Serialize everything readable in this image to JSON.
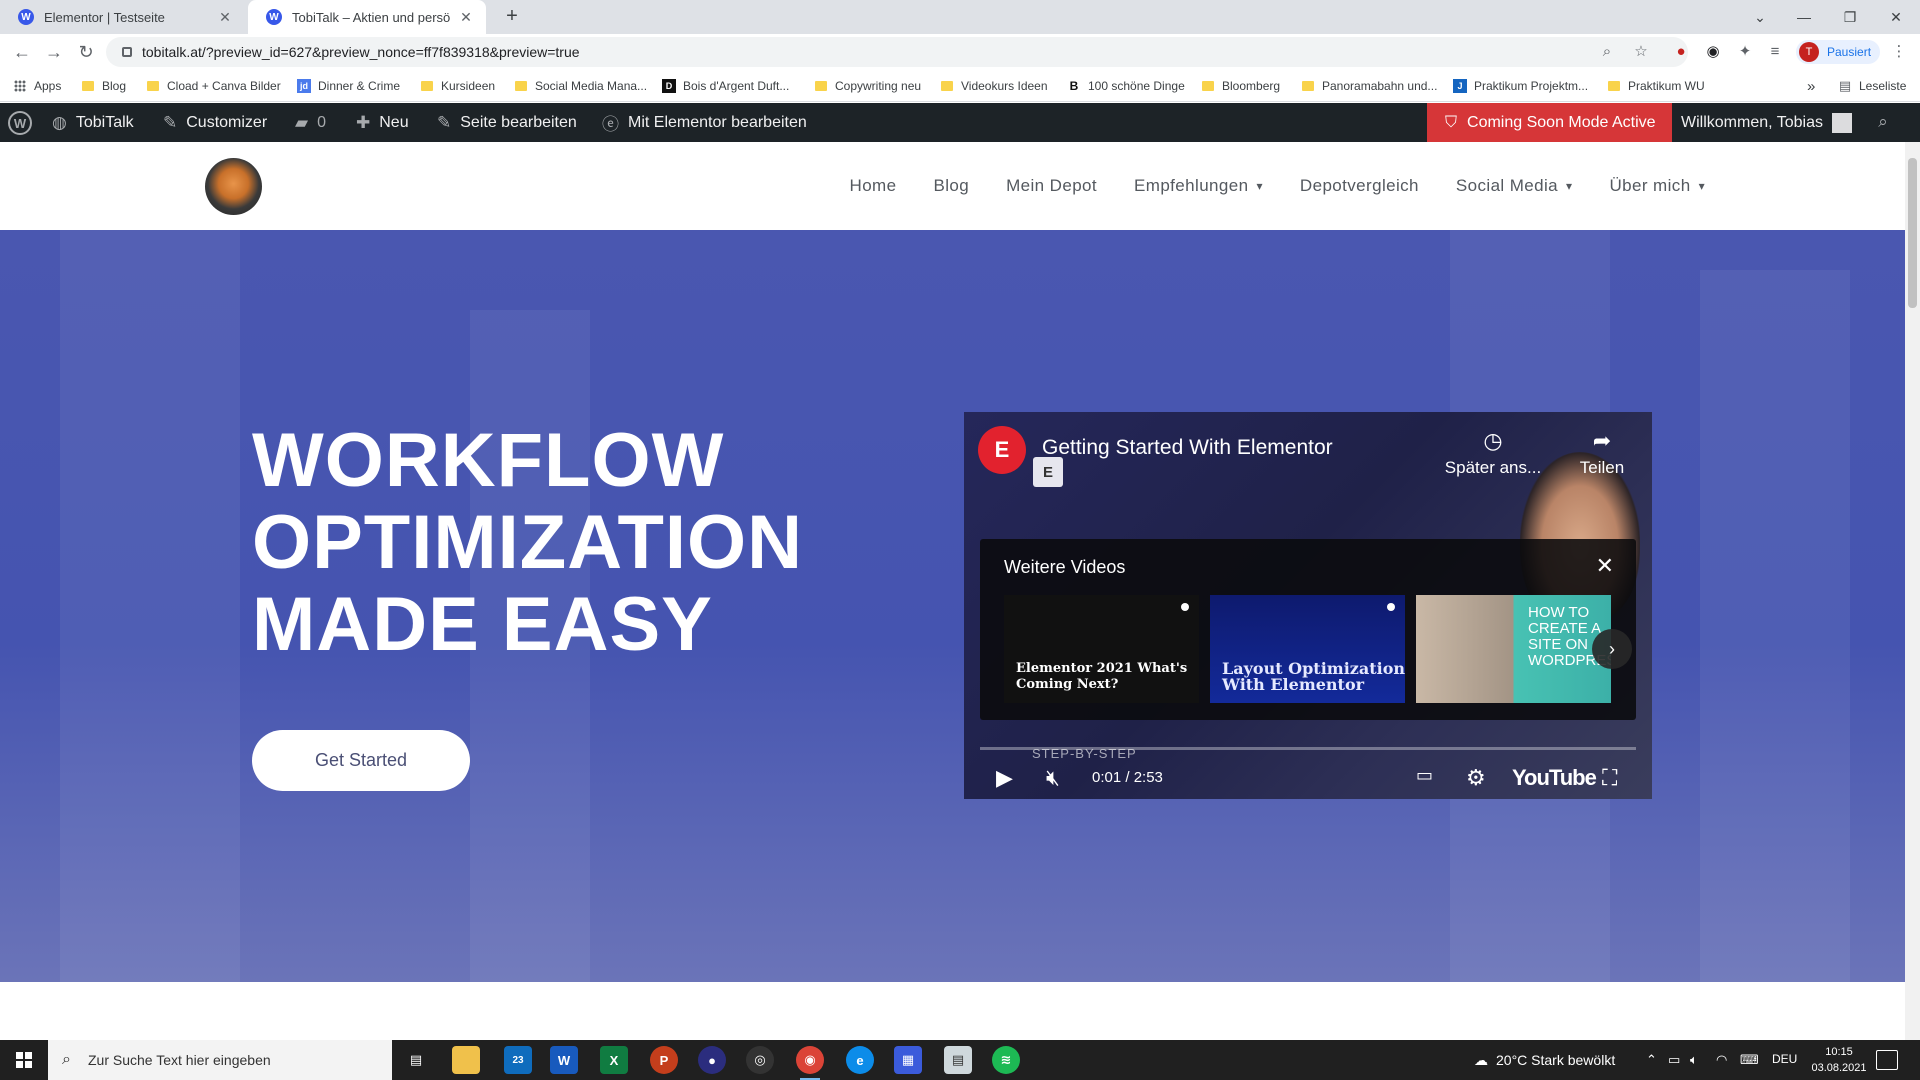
{
  "browser": {
    "tabs": [
      {
        "title": "Elementor | Testseite",
        "active": false
      },
      {
        "title": "TobiTalk – Aktien und persönlich",
        "active": true
      }
    ],
    "url": "tobitalk.at/?preview_id=627&preview_nonce=ff7f839318&preview=true",
    "profile_status": "Pausiert",
    "profile_initial": "T",
    "bookmarks": [
      "Apps",
      "Blog",
      "Cload + Canva Bilder",
      "Dinner & Crime",
      "Kursideen",
      "Social Media Mana...",
      "Bois d'Argent Duft...",
      "Copywriting neu",
      "Videokurs Ideen",
      "100 schöne Dinge",
      "Bloomberg",
      "Panoramabahn und...",
      "Praktikum Projektm...",
      "Praktikum WU"
    ],
    "bookmark_overflow": "»",
    "reading_list": "Leseliste"
  },
  "wp_admin": {
    "site_name": "TobiTalk",
    "customizer": "Customizer",
    "comments_count": "0",
    "new": "Neu",
    "edit_page": "Seite bearbeiten",
    "edit_elementor": "Mit Elementor bearbeiten",
    "coming_soon": "Coming Soon Mode Active",
    "welcome": "Willkommen, Tobias"
  },
  "site": {
    "nav": [
      {
        "label": "Home",
        "dropdown": false
      },
      {
        "label": "Blog",
        "dropdown": false
      },
      {
        "label": "Mein Depot",
        "dropdown": false
      },
      {
        "label": "Empfehlungen",
        "dropdown": true
      },
      {
        "label": "Depotvergleich",
        "dropdown": false
      },
      {
        "label": "Social Media",
        "dropdown": true
      },
      {
        "label": "Über mich",
        "dropdown": true
      }
    ],
    "hero": {
      "title_lines": [
        "WORKFLOW",
        "OPTIMIZATION",
        "MADE EASY"
      ],
      "cta": "Get Started"
    }
  },
  "video": {
    "title": "Getting Started With Elementor",
    "watch_later": "Später ans...",
    "share": "Teilen",
    "more_videos": "Weitere Videos",
    "thumbnails": [
      {
        "text": "Elementor 2021 What's Coming Next?"
      },
      {
        "text": "Layout Optimization With Elementor"
      },
      {
        "text": "HOW TO CREATE A SITE ON WORDPRESS"
      }
    ],
    "step_label": "STEP-BY-STEP",
    "time": "0:01 / 2:53",
    "brand": "YouTube",
    "colors": {
      "elementor_red": "#e2222e"
    }
  },
  "taskbar": {
    "search_placeholder": "Zur Suche Text hier eingeben",
    "mail_badge": "23",
    "weather": "20°C  Stark bewölkt",
    "language": "DEU",
    "time": "10:15",
    "date": "03.08.2021"
  },
  "colors": {
    "hero_bg": "#4a57b0",
    "admin_bar": "#1d2327",
    "coming_soon": "#d63638"
  }
}
